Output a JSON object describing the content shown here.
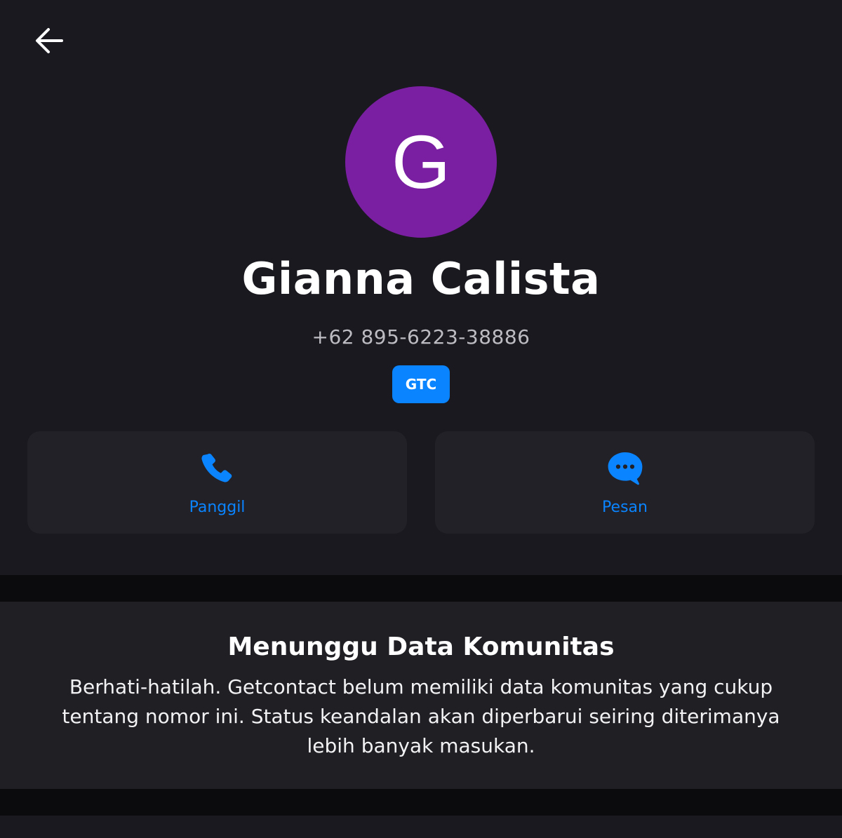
{
  "colors": {
    "accent": "#0a84ff",
    "avatar": "#7a1fa2",
    "profile_background": "#1a191f",
    "card_background": "#222127",
    "section_background": "#1f1f24",
    "separator": "#0b0b0d"
  },
  "header": {
    "back_icon": "arrow-left-icon"
  },
  "profile": {
    "avatar_letter": "G",
    "name": "Gianna Calista",
    "phone": "+62 895-6223-38886",
    "badge": "GTC"
  },
  "actions": [
    {
      "icon": "phone-icon",
      "label": "Panggil"
    },
    {
      "icon": "chat-bubble-icon",
      "label": "Pesan"
    }
  ],
  "community": {
    "title": "Menunggu Data Komunitas",
    "description": "Berhati-hatilah. Getcontact belum memiliki data komunitas yang cukup tentang nomor ini. Status keandalan akan diperbarui seiring diterimanya lebih banyak masukan."
  }
}
